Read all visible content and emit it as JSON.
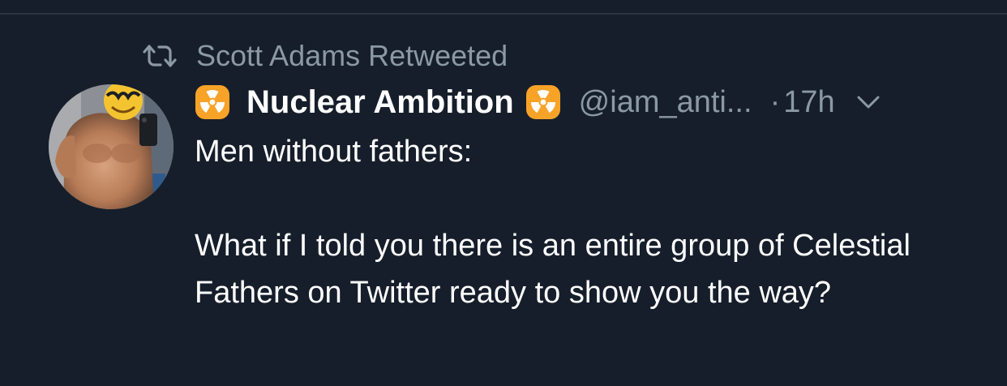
{
  "retweet": {
    "icon": "retweet-icon",
    "label": "Scott Adams Retweeted"
  },
  "tweet": {
    "avatar": "user-avatar",
    "name_prefix_icon": "radioactive-emoji-icon",
    "display_name": "Nuclear Ambition",
    "name_suffix_icon": "radioactive-emoji-icon",
    "handle": "@iam_anti...",
    "separator": "·",
    "timestamp": "17h",
    "menu_icon": "chevron-down-icon",
    "text_line1": "Men without fathers:",
    "text_para2": "What if I told you there is an entire group of Celestial Fathers on Twitter ready to show you the way?"
  },
  "colors": {
    "background": "#161e2b",
    "secondary_text": "#8b98a5",
    "primary_text": "#ffffff",
    "emoji_orange": "#f7a328"
  }
}
